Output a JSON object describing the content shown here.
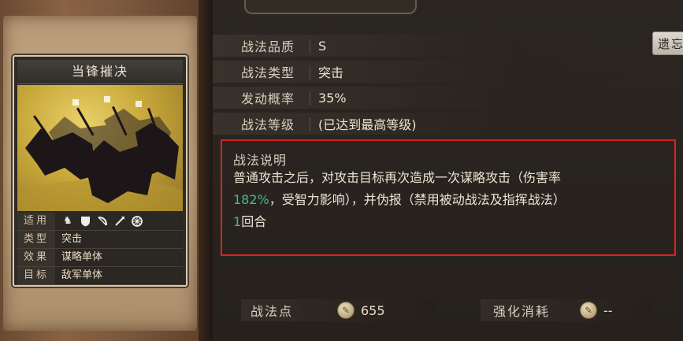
{
  "card": {
    "title": "当锋摧决",
    "rows": [
      {
        "key": "适用",
        "value": ""
      },
      {
        "key": "类型",
        "value": "突击"
      },
      {
        "key": "效果",
        "value": "谋略单体"
      },
      {
        "key": "目标",
        "value": "敌军单体"
      }
    ],
    "applicable_icons": [
      "cavalry-icon",
      "shield-icon",
      "bow-icon",
      "spear-icon",
      "wheel-icon"
    ]
  },
  "stats": [
    {
      "label": "战法品质",
      "value": "S"
    },
    {
      "label": "战法类型",
      "value": "突击"
    },
    {
      "label": "发动概率",
      "value": "35%"
    },
    {
      "label": "战法等级",
      "value": "(已达到最高等级)"
    }
  ],
  "replace_button": "遗忘",
  "description": {
    "title": "战法说明",
    "line1": "普通攻击之后，对攻击目标再次造成一次谋略攻击（伤害率",
    "line2_highlight": "182%",
    "line2_rest": "，受智力影响），并伪报（禁用被动战法及指挥战法）",
    "line3_highlight": "1",
    "line3_rest": "回合"
  },
  "bottom": {
    "points_label": "战法点",
    "points_value": "655",
    "cost_label": "强化消耗",
    "cost_value": "--"
  },
  "colors": {
    "highlight": "#3bc27a",
    "frame": "#d82420"
  }
}
